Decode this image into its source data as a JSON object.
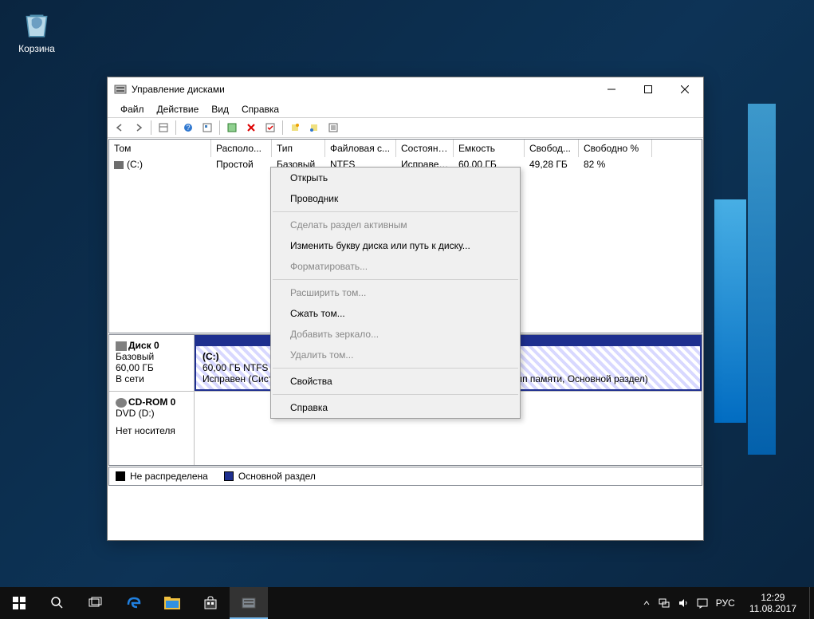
{
  "desktop": {
    "recycle_bin": "Корзина"
  },
  "window": {
    "title": "Управление дисками",
    "menu": {
      "file": "Файл",
      "action": "Действие",
      "view": "Вид",
      "help": "Справка"
    },
    "columns": {
      "volume": "Том",
      "layout": "Располо...",
      "type": "Тип",
      "fs": "Файловая с...",
      "status": "Состояние",
      "capacity": "Емкость",
      "free": "Свобод...",
      "freepct": "Свободно %"
    },
    "row": {
      "volume": "(C:)",
      "layout": "Простой",
      "type": "Базовый",
      "fs": "NTFS",
      "status": "Исправен...",
      "capacity": "60,00 ГБ",
      "free": "49,28 ГБ",
      "freepct": "82 %"
    },
    "disk0": {
      "name": "Диск 0",
      "type": "Базовый",
      "size": "60,00 ГБ",
      "state": "В сети",
      "vol_label": "(C:)",
      "vol_size": "60,00 ГБ NTFS",
      "vol_status": "Исправен (Система, Загрузка, Файл подкачки, Активен, Аварийный дамп памяти, Основной раздел)"
    },
    "cdrom": {
      "name": "CD-ROM 0",
      "type": "DVD (D:)",
      "state": "Нет носителя"
    },
    "legend": {
      "unalloc": "Не распределена",
      "primary": "Основной раздел"
    }
  },
  "context": {
    "open": "Открыть",
    "explorer": "Проводник",
    "make_active": "Сделать раздел активным",
    "change_letter": "Изменить букву диска или путь к диску...",
    "format": "Форматировать...",
    "extend": "Расширить том...",
    "shrink": "Сжать том...",
    "mirror": "Добавить зеркало...",
    "delete": "Удалить том...",
    "properties": "Свойства",
    "help": "Справка"
  },
  "taskbar": {
    "lang": "РУС",
    "time": "12:29",
    "date": "11.08.2017"
  }
}
